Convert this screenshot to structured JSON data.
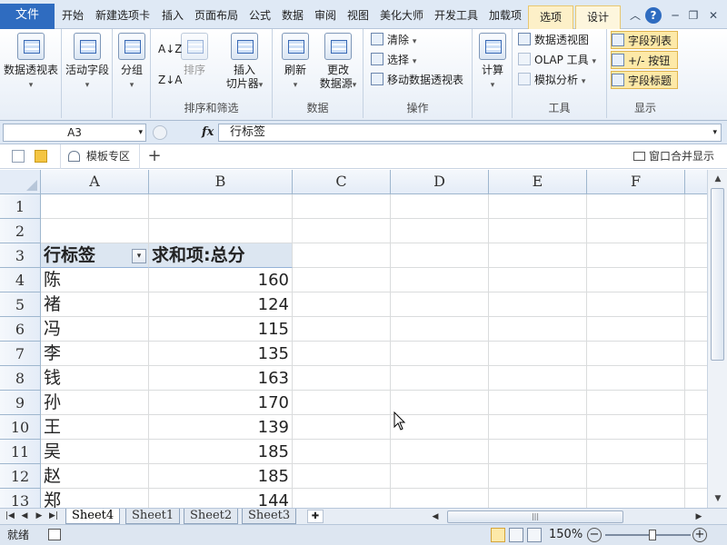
{
  "ribbon_tabs": {
    "file": "文件",
    "home": "开始",
    "new_tab": "新建选项卡",
    "insert": "插入",
    "layout": "页面布局",
    "formulas": "公式",
    "data": "数据",
    "review": "审阅",
    "view": "视图",
    "meihua": "美化大师",
    "developer": "开发工具",
    "addins": "加载项",
    "options": "选项",
    "design": "设计"
  },
  "ribbon": {
    "pivot_table": "数据透视表",
    "active_field": "活动字段",
    "group": "分组",
    "sort_label": "排序",
    "insert_slicer_1": "插入",
    "insert_slicer_2": "切片器",
    "group_sort_filter": "排序和筛选",
    "refresh": "刷新",
    "change_source_1": "更改",
    "change_source_2": "数据源",
    "group_data": "数据",
    "clear": "清除",
    "select": "选择",
    "move_pivot": "移动数据透视表",
    "group_actions": "操作",
    "calculations": "计算",
    "pivot_chart": "数据透视图",
    "olap_tools": "OLAP 工具",
    "what_if": "模拟分析",
    "group_tools": "工具",
    "field_list": "字段列表",
    "buttons": "+/- 按钮",
    "field_headers": "字段标题",
    "group_show": "显示"
  },
  "formula_bar": {
    "name_box": "A3",
    "fx": "fx",
    "content": "行标签"
  },
  "doc_tabs": {
    "template_area": "模板专区",
    "merge_display": "窗口合并显示"
  },
  "columns": [
    "A",
    "B",
    "C",
    "D",
    "E",
    "F"
  ],
  "rows": [
    {
      "n": "1",
      "a": "",
      "b": ""
    },
    {
      "n": "2",
      "a": "",
      "b": ""
    },
    {
      "n": "3",
      "a": "行标签",
      "b": "求和项:总分"
    },
    {
      "n": "4",
      "a": "陈",
      "b": "160"
    },
    {
      "n": "5",
      "a": "褚",
      "b": "124"
    },
    {
      "n": "6",
      "a": "冯",
      "b": "115"
    },
    {
      "n": "7",
      "a": "李",
      "b": "135"
    },
    {
      "n": "8",
      "a": "钱",
      "b": "163"
    },
    {
      "n": "9",
      "a": "孙",
      "b": "170"
    },
    {
      "n": "10",
      "a": "王",
      "b": "139"
    },
    {
      "n": "11",
      "a": "吴",
      "b": "185"
    },
    {
      "n": "12",
      "a": "赵",
      "b": "185"
    },
    {
      "n": "13",
      "a": "郑",
      "b": "144"
    }
  ],
  "sheets": [
    {
      "label": "Sheet4",
      "active": true
    },
    {
      "label": "Sheet1",
      "active": false
    },
    {
      "label": "Sheet2",
      "active": false
    },
    {
      "label": "Sheet3",
      "active": false
    }
  ],
  "status": {
    "ready": "就绪",
    "zoom": "150%",
    "zoom_fraction": 0.55
  },
  "colors": {
    "file_tab": "#2f6cc0",
    "pivot_header": "#dce6f1",
    "toggle_on": "#fde9a8"
  }
}
